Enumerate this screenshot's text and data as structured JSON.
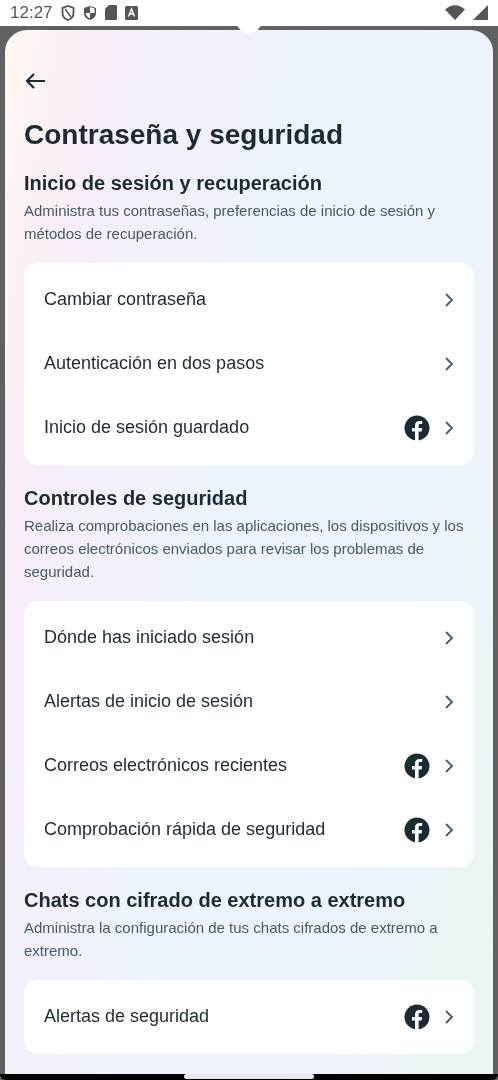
{
  "status_bar": {
    "time": "12:27"
  },
  "title": "Contraseña y seguridad",
  "sections": [
    {
      "heading": "Inicio de sesión y recuperación",
      "description": "Administra tus contraseñas, preferencias de inicio de sesión y métodos de recuperación.",
      "items": [
        {
          "label": "Cambiar contraseña",
          "kind": "plain"
        },
        {
          "label": "Autenticación en dos pasos",
          "kind": "plain"
        },
        {
          "label": "Inicio de sesión guardado",
          "kind": "facebook"
        }
      ]
    },
    {
      "heading": "Controles de seguridad",
      "description": "Realiza comprobaciones en las aplicaciones, los dispositivos y los correos electrónicos enviados para revisar los problemas de seguridad.",
      "items": [
        {
          "label": "Dónde has iniciado sesión",
          "kind": "plain"
        },
        {
          "label": "Alertas de inicio de sesión",
          "kind": "plain"
        },
        {
          "label": "Correos electrónicos recientes",
          "kind": "facebook"
        },
        {
          "label": "Comprobación rápida de seguridad",
          "kind": "facebook"
        }
      ]
    },
    {
      "heading": "Chats con cifrado de extremo a extremo",
      "description": "Administra la configuración de tus chats cifrados de extremo a extremo.",
      "items": [
        {
          "label": "Alertas de seguridad",
          "kind": "facebook"
        }
      ]
    }
  ]
}
